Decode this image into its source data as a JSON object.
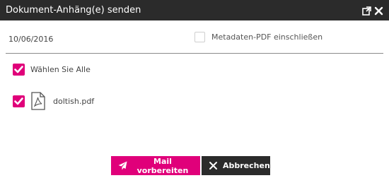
{
  "dialog": {
    "title": "Dokument-Anhäng(e) senden",
    "icons": [
      "external-link-icon",
      "close-icon"
    ]
  },
  "form": {
    "date": "10/06/2016",
    "include_metadata": {
      "label": "Metadaten-PDF einschließen",
      "checked": false
    },
    "select_all": {
      "label": "Wählen Sie Alle",
      "checked": true
    },
    "files": [
      {
        "name": "doltish.pdf",
        "checked": true,
        "icon": "pdf-file-icon"
      }
    ]
  },
  "buttons": {
    "prepare_label": "Mail vorbereiten",
    "prepare_icon": "paper-plane-icon",
    "cancel_label": "Abbrechen",
    "cancel_icon": "close-icon"
  },
  "colors": {
    "accent": "#e0007a",
    "titlebar": "#2b2b2b",
    "divider": "#8a8a8a"
  }
}
